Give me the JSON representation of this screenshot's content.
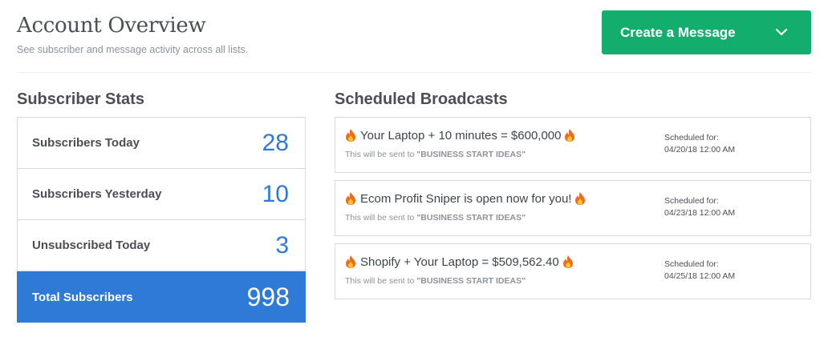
{
  "header": {
    "title": "Account Overview",
    "subtitle": "See subscriber and message activity across all lists."
  },
  "create_button": {
    "label": "Create a Message",
    "icon": "chevron-down-icon",
    "color": "#13ad6e"
  },
  "subscriber_stats": {
    "title": "Subscriber Stats",
    "rows": [
      {
        "label": "Subscribers Today",
        "value": "28"
      },
      {
        "label": "Subscribers Yesterday",
        "value": "10"
      },
      {
        "label": "Unsubscribed Today",
        "value": "3"
      }
    ],
    "total": {
      "label": "Total Subscribers",
      "value": "998"
    },
    "accent_color": "#2f7ad6"
  },
  "broadcasts": {
    "title": "Scheduled Broadcasts",
    "items": [
      {
        "title": "Your Laptop + 10 minutes = $600,000",
        "sent_to_prefix": "This will be sent to ",
        "list": "\"BUSINESS START IDEAS\"",
        "scheduled_label": "Scheduled for:",
        "scheduled_at": "04/20/18 12:00 AM"
      },
      {
        "title": "Ecom Profit Sniper is open now for you!",
        "sent_to_prefix": "This will be sent to ",
        "list": "\"BUSINESS START IDEAS\"",
        "scheduled_label": "Scheduled for:",
        "scheduled_at": "04/23/18 12:00 AM"
      },
      {
        "title": "Shopify + Your Laptop = $509,562.40",
        "sent_to_prefix": "This will be sent to ",
        "list": "\"BUSINESS START IDEAS\"",
        "scheduled_label": "Scheduled for:",
        "scheduled_at": "04/25/18 12:00 AM"
      }
    ],
    "title_icon": "fire-icon"
  }
}
